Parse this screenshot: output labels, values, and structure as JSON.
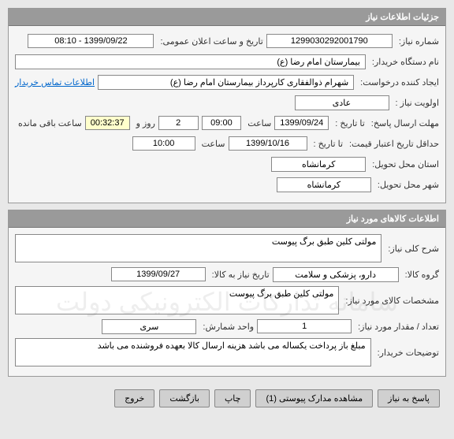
{
  "panel1": {
    "title": "جزئیات اطلاعات نیاز",
    "need_no_label": "شماره نیاز:",
    "need_no": "1299030292001790",
    "announce_label": "تاریخ و ساعت اعلان عمومی:",
    "announce_val": "1399/09/22 - 08:10",
    "buyer_label": "نام دستگاه خریدار:",
    "buyer_val": "بیمارستان امام رضا (ع)",
    "requester_label": "ایجاد کننده درخواست:",
    "requester_val": "شهرام ذوالفقاری کارپرداز بیمارستان امام رضا (ع)",
    "contact_link": "اطلاعات تماس خریدار",
    "priority_label": "اولویت نیاز :",
    "priority_val": "عادی",
    "deadline_label": "مهلت ارسال پاسخ:",
    "to_date_label": "تا تاریخ :",
    "to_date_val": "1399/09/24",
    "time_label": "ساعت",
    "to_time_val": "09:00",
    "days_val": "2",
    "days_label": "روز و",
    "remain_val": "00:32:37",
    "remain_label": "ساعت باقی مانده",
    "validity_label": "حداقل تاریخ اعتبار قیمت:",
    "validity_to_label": "تا تاریخ :",
    "validity_date": "1399/10/16",
    "validity_time": "10:00",
    "province_label": "استان محل تحویل:",
    "province_val": "کرمانشاه",
    "city_label": "شهر محل تحویل:",
    "city_val": "کرمانشاه"
  },
  "panel2": {
    "title": "اطلاعات کالاهای مورد نیاز",
    "desc_label": "شرح کلی نیاز:",
    "desc_val": "مولتی کلین طبق برگ پیوست",
    "group_label": "گروه کالا:",
    "group_val": "دارو، پزشکی و سلامت",
    "need_to_label": "تاریخ نیاز به کالا:",
    "need_to_val": "1399/09/27",
    "spec_label": "مشخصات کالای مورد نیاز:",
    "spec_val": "مولتی کلین طبق برگ پیوست",
    "qty_label": "تعداد / مقدار مورد نیاز:",
    "qty_val": "1",
    "unit_label": "واحد شمارش:",
    "unit_val": "سری",
    "notes_label": "توضیحات خریدار:",
    "notes_val": "مبلغ باز پرداخت یکساله می باشد هزینه ارسال کالا بعهده فروشنده می باشد"
  },
  "actions": {
    "reply": "پاسخ به نیاز",
    "attach": "مشاهده مدارک پیوستی (1)",
    "print": "چاپ",
    "back": "بازگشت",
    "exit": "خروج"
  }
}
